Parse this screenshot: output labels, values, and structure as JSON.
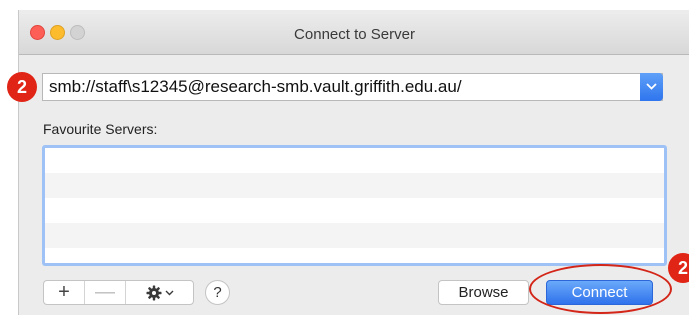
{
  "window": {
    "title": "Connect to Server"
  },
  "annotations": {
    "step_badge_1": "2",
    "step_badge_2": "2"
  },
  "server_address": {
    "value": "smb://staff\\s12345@research-smb.vault.griffith.edu.au/"
  },
  "favourites": {
    "label": "Favourite Servers:",
    "items": []
  },
  "toolbar": {
    "add_label": "+",
    "remove_label": "—",
    "action_caret": "⌄",
    "help_label": "?"
  },
  "buttons": {
    "browse_label": "Browse",
    "connect_label": "Connect"
  },
  "colors": {
    "accent": "#2f72ec",
    "annotation": "#e02415"
  }
}
